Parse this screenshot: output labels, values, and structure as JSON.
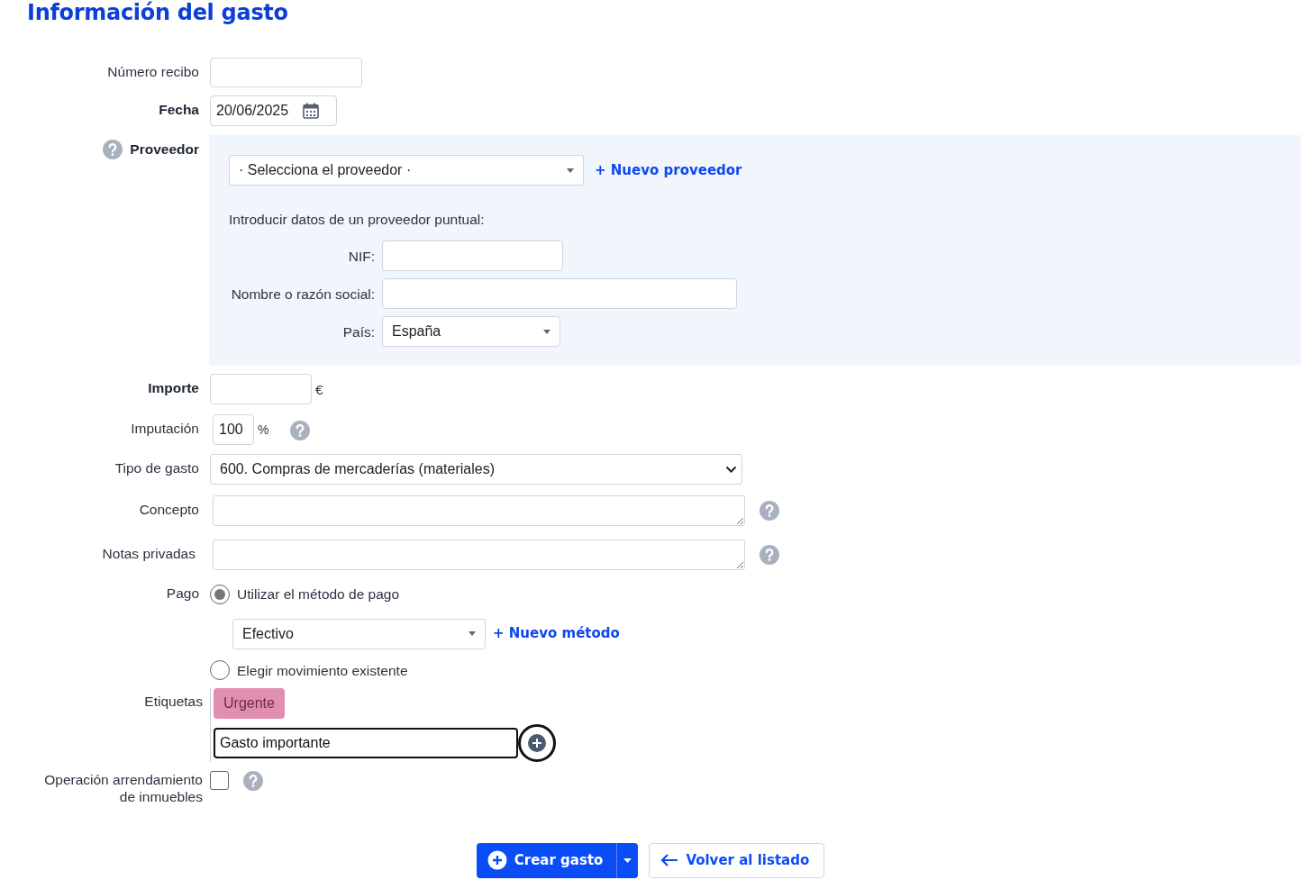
{
  "title": "Información del gasto",
  "receipt_number": {
    "label": "Número recibo",
    "required": false
  },
  "date": {
    "label": "Fecha",
    "required": true,
    "value": "20/06/2025"
  },
  "supplier": {
    "label": "Proveedor",
    "required": true,
    "select": "· Selecciona el proveedor ·",
    "new_link": "+ Nuevo proveedor",
    "oneoff_intro": "Introducir datos de un proveedor puntual:",
    "nif_label": "NIF:",
    "name_label": "Nombre o razón social:",
    "country_label": "País:",
    "country": "España"
  },
  "amount": {
    "label": "Importe",
    "required": true,
    "unit": "€"
  },
  "imputation": {
    "label": "Imputación",
    "required": false,
    "value": "100",
    "unit": "%"
  },
  "expense_type": {
    "label": "Tipo de gasto",
    "required": false,
    "value": "600. Compras de mercaderías (materiales)"
  },
  "concept": {
    "label": "Concepto",
    "required": false
  },
  "private_notes": {
    "label": "Notas privadas",
    "required": false
  },
  "payment": {
    "label": "Pago",
    "required": false,
    "method": "Efectivo",
    "new_link": "+ Nuevo método",
    "options": [
      {
        "label": "Utilizar el método de pago",
        "selected": true
      },
      {
        "label": "Elegir movimiento existente",
        "selected": false
      }
    ]
  },
  "tags": {
    "label": "Etiquetas",
    "required": false,
    "items": [
      "Urgente"
    ],
    "input_value": "Gasto importante"
  },
  "lease": {
    "label": "Operación arrendamiento de inmuebles",
    "required": false,
    "checked": false
  },
  "buttons": {
    "create": "Crear gasto",
    "back": "Volver al listado"
  }
}
